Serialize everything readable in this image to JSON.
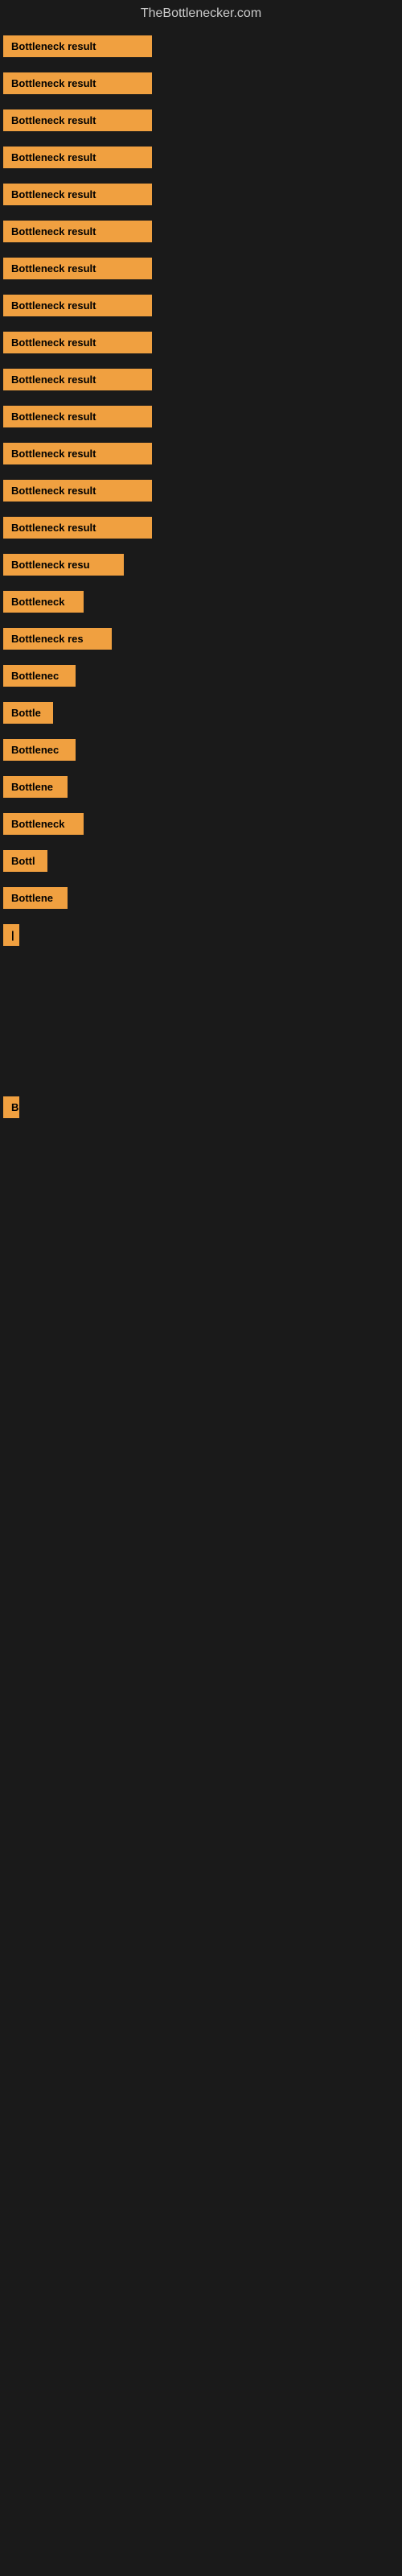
{
  "site": {
    "title": "TheBottlenecker.com"
  },
  "bars": [
    {
      "label": "Bottleneck result",
      "width": 185
    },
    {
      "label": "Bottleneck result",
      "width": 185
    },
    {
      "label": "Bottleneck result",
      "width": 185
    },
    {
      "label": "Bottleneck result",
      "width": 185
    },
    {
      "label": "Bottleneck result",
      "width": 185
    },
    {
      "label": "Bottleneck result",
      "width": 185
    },
    {
      "label": "Bottleneck result",
      "width": 185
    },
    {
      "label": "Bottleneck result",
      "width": 185
    },
    {
      "label": "Bottleneck result",
      "width": 185
    },
    {
      "label": "Bottleneck result",
      "width": 185
    },
    {
      "label": "Bottleneck result",
      "width": 185
    },
    {
      "label": "Bottleneck result",
      "width": 185
    },
    {
      "label": "Bottleneck result",
      "width": 185
    },
    {
      "label": "Bottleneck result",
      "width": 185
    },
    {
      "label": "Bottleneck resu",
      "width": 150
    },
    {
      "label": "Bottleneck",
      "width": 100
    },
    {
      "label": "Bottleneck res",
      "width": 135
    },
    {
      "label": "Bottlenec",
      "width": 90
    },
    {
      "label": "Bottle",
      "width": 62
    },
    {
      "label": "Bottlenec",
      "width": 90
    },
    {
      "label": "Bottlene",
      "width": 80
    },
    {
      "label": "Bottleneck",
      "width": 100
    },
    {
      "label": "Bottl",
      "width": 55
    },
    {
      "label": "Bottlene",
      "width": 80
    },
    {
      "label": "|",
      "width": 14
    },
    {
      "label": "",
      "width": 0
    },
    {
      "label": "",
      "width": 0
    },
    {
      "label": "",
      "width": 0
    },
    {
      "label": "",
      "width": 0
    },
    {
      "label": "B",
      "width": 18
    },
    {
      "label": "",
      "width": 0
    },
    {
      "label": "",
      "width": 0
    },
    {
      "label": "",
      "width": 0
    },
    {
      "label": "",
      "width": 0
    },
    {
      "label": "",
      "width": 0
    },
    {
      "label": "",
      "width": 0
    }
  ]
}
